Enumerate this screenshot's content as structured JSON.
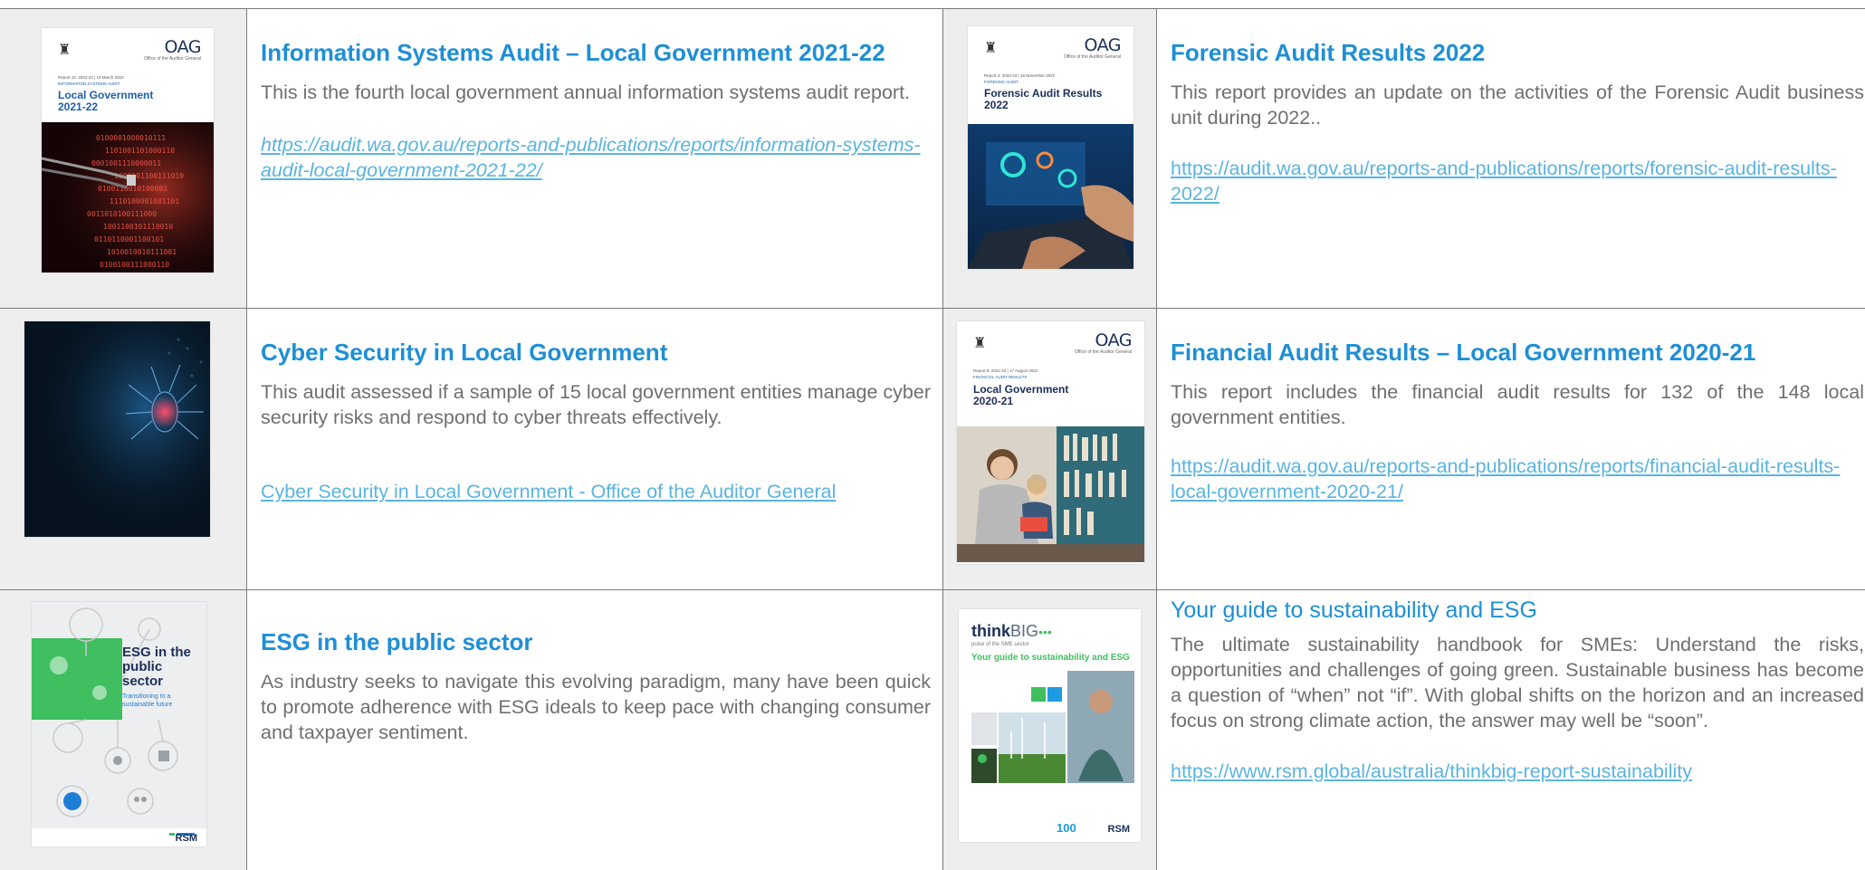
{
  "rows": [
    {
      "left": {
        "cover": {
          "kind": "oag",
          "oag": "OAG",
          "oag_sub": "Office of the Auditor General",
          "meta1": "Report 15: 2022-23 | 19 March 2023",
          "meta2": "INFORMATION SYSTEMS AUDIT",
          "title_l1": "Local Government",
          "title_l2": "2021-22"
        },
        "title": "Information Systems Audit – Local Government 2021-22",
        "desc": "This is the fourth local government annual information systems audit report.",
        "link": "https://audit.wa.gov.au/reports-and-publications/reports/information-systems-audit-local-government-2021-22/"
      },
      "right": {
        "cover": {
          "kind": "oag",
          "oag": "OAG",
          "oag_sub": "Office of the Auditor General",
          "meta1": "Report 4: 2022-23 | 16 November 2022",
          "meta2": "FORENSIC AUDIT",
          "title_l1": "Forensic Audit Results",
          "title_l2": "2022"
        },
        "title": "Forensic Audit Results 2022",
        "desc": "This report provides an update on the activities of the Forensic Audit business unit during 2022..",
        "link": "https://audit.wa.gov.au/reports-and-publications/reports/forensic-audit-results-2022/"
      }
    },
    {
      "left": {
        "cover": {
          "kind": "cyber"
        },
        "title": "Cyber Security in Local Government",
        "desc": "This audit assessed if a sample of 15 local government entities manage cyber security risks and respond to cyber threats effectively.",
        "link": "Cyber Security in Local Government - Office of the Auditor General"
      },
      "right": {
        "cover": {
          "kind": "oag",
          "oag": "OAG",
          "oag_sub": "Office of the Auditor General",
          "meta1": "Report 8: 2022-23 | 17 August 2022",
          "meta2": "FINANCIAL AUDIT RESULTS",
          "title_l1": "Local Government",
          "title_l2": "2020-21"
        },
        "title": "Financial Audit Results – Local Government 2020-21",
        "desc": "This report includes the financial audit results for 132 of the 148 local government entities.",
        "link": "https://audit.wa.gov.au/reports-and-publications/reports/financial-audit-results-local-government-2020-21/"
      }
    },
    {
      "left": {
        "cover": {
          "kind": "esg",
          "title": "ESG in the public sector",
          "subtitle": "Transitioning to a sustainable future",
          "brand": "RSM"
        },
        "title": "ESG in the public sector",
        "desc": "As industry seeks to navigate this evolving paradigm, many have been quick to promote adherence with ESG ideals to keep pace with changing consumer and taxpayer sentiment."
      },
      "right": {
        "cover": {
          "kind": "thinkbig",
          "brand_a": "think",
          "brand_b": "BIG",
          "tagline": "pulse of the SME sector",
          "title": "Your guide to sustainability and ESG",
          "badge": "100",
          "brand": "RSM"
        },
        "title": "Your guide to sustainability and ESG",
        "desc": "The ultimate sustainability handbook for SMEs: Understand the risks, opportunities and challenges of going green. Sustainable business has become a question of “when” not “if”. With global shifts on the horizon and an increased focus on strong climate action, the answer may well be “soon”.",
        "link": "https://www.rsm.global/australia/thinkbig-report-sustainability"
      }
    }
  ],
  "colors": {
    "title": "#1e8fd6",
    "text": "#6f6f6f",
    "link": "#5ab4e0",
    "border": "#7a7a7a",
    "thumb_bg": "#eeeeee"
  }
}
